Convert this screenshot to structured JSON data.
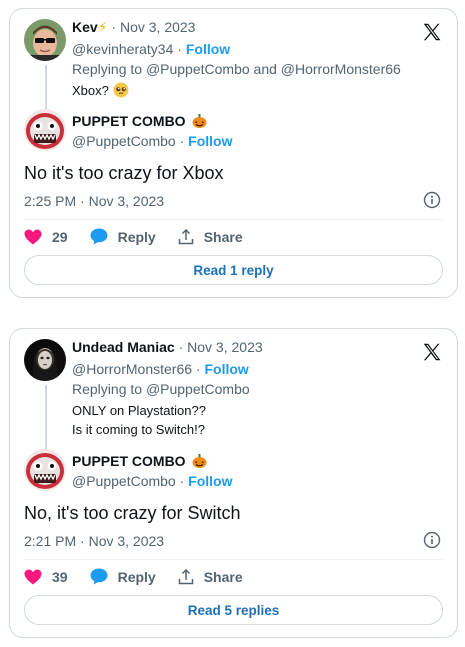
{
  "tweets": [
    {
      "parent": {
        "name": "Kev",
        "badge": "⚡",
        "date": " · Nov 3, 2023",
        "handle": "@kevinheraty34",
        "follow": "Follow",
        "replying_prefix": "Replying to ",
        "replying_users": "@PuppetCombo and @HorrorMonster66",
        "text_lines": [
          "Xbox?"
        ]
      },
      "main": {
        "name": "PUPPET COMBO",
        "handle": "@PuppetCombo",
        "follow": "Follow",
        "text": "No it's too crazy for Xbox",
        "time": "2:25 PM · Nov 3, 2023"
      },
      "actions": {
        "likes": "29",
        "reply": "Reply",
        "share": "Share"
      },
      "read_replies": "Read 1 reply"
    },
    {
      "parent": {
        "name": "Undead Maniac",
        "date": " · Nov 3, 2023",
        "handle": "@HorrorMonster66",
        "follow": "Follow",
        "replying_prefix": "Replying to ",
        "replying_users": "@PuppetCombo",
        "text_lines": [
          "ONLY on Playstation??",
          "Is it coming to Switch!?"
        ]
      },
      "main": {
        "name": "PUPPET COMBO",
        "handle": "@PuppetCombo",
        "follow": "Follow",
        "text": "No, it's too crazy for Switch",
        "time": "2:21 PM · Nov 3, 2023"
      },
      "actions": {
        "likes": "39",
        "reply": "Reply",
        "share": "Share"
      },
      "read_replies": "Read 5 replies"
    }
  ],
  "colors": {
    "like": "#f91880",
    "reply": "#1d9bf0",
    "link": "#1d6fb8",
    "muted": "#536471"
  },
  "icons": [
    "x-logo-icon",
    "info-icon",
    "heart-icon",
    "reply-bubble-icon",
    "share-icon",
    "pumpkin-emoji-icon",
    "pleading-face-emoji-icon",
    "lightning-bolt-icon"
  ]
}
